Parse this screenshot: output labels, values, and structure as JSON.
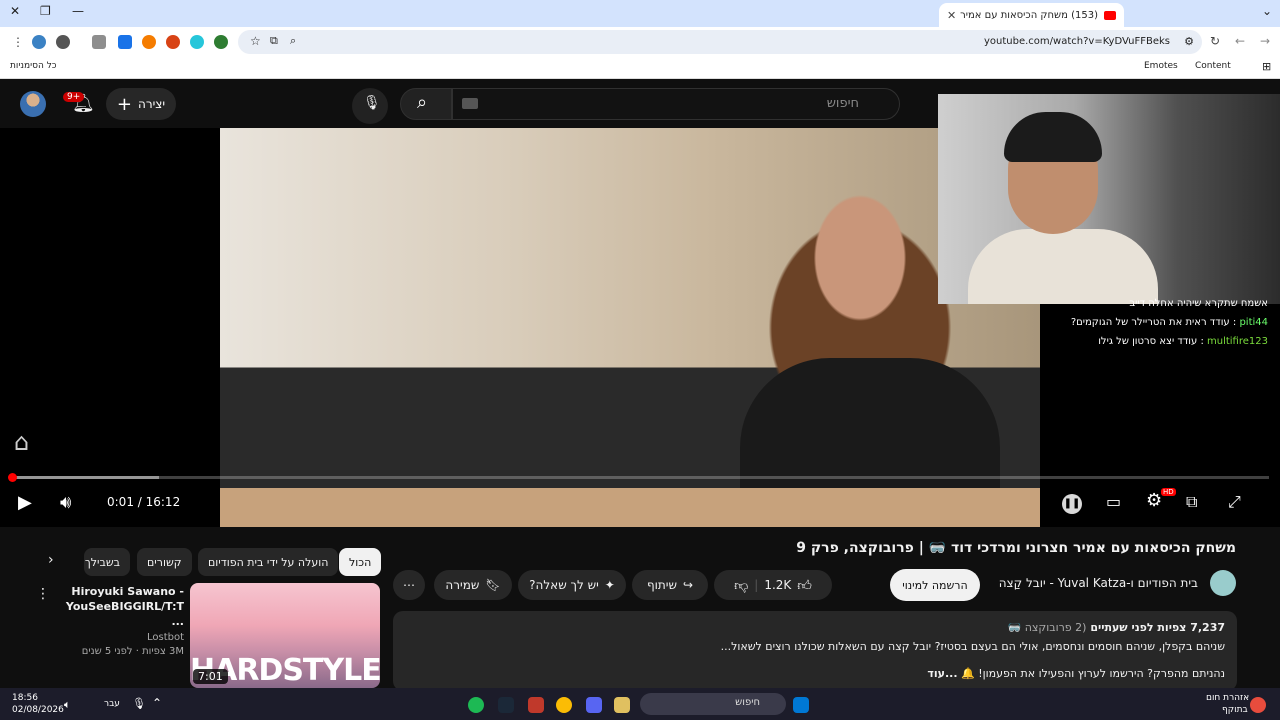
{
  "browser": {
    "tab_title": "(153) משחק הכיסאות עם אמיר",
    "tab_close": "✕",
    "new_tab": "+",
    "url": "youtube.com/watch?v=KyDVuFFBeks",
    "bookmarks": {
      "all_bookmarks": "כל הסימניות",
      "emotes": "Emotes",
      "content": "Content"
    }
  },
  "header": {
    "search_placeholder": "חיפוש",
    "create_label": "יצירה",
    "notification_count": "9+"
  },
  "stream_overlay": {
    "chat": [
      {
        "text": "אשמח שתקרא שיהיה אחלה דייב",
        "user": ""
      },
      {
        "user": "piti44",
        "text": ": עודד ראית את הטריילר של הגוקמים?"
      },
      {
        "user": "multifire123",
        "text": ": עודד יצא סרטון של גילו"
      }
    ]
  },
  "player": {
    "current_time": "0:01",
    "duration": "16:12",
    "time_display": "0:01 / 16:12",
    "progress": 0.001,
    "hd_badge": "HD"
  },
  "video": {
    "title": "משחק הכיסאות עם אמיר חצרוני ומרדכי דוד 🥽 | פרובוקצה, פרק 9",
    "channel": "בית הפודיום ו-Yuval Katza - יובל קַצה",
    "subscribe": "הרשמה למינוי",
    "likes": "1.2K",
    "share": "שיתוף",
    "ask": "יש לך שאלה?",
    "save": "שמירה",
    "views": "7,237 צפיות",
    "age": "לפני שעתיים",
    "tag": "(2 פרובוקצה 🥽",
    "description_line1": "שניהם בקפלן, שניהם חוסמים ונחסמים, אולי הם בעצם בסטיז? יובל קצה עם השאלות שכולנו רוצים לשאול...",
    "description_line2": "נהניתם מהפרק? הירשמו לערוץ והפעילו את הפעמון! 🔔",
    "more": "...עוד"
  },
  "chips": [
    "הכול",
    "הועלה על ידי בית הפודיום",
    "קשורים",
    "בשבילך"
  ],
  "recommendation": {
    "title": "Hiroyuki Sawano - YouSeeBIGGIRL/T:T ...",
    "channel": "Lostbot",
    "meta": "3M צפיות · לפני 5 שנים",
    "duration": "7:01",
    "thumb_text": "HARDSTYLE"
  },
  "taskbar": {
    "time": "18:56",
    "date": "02/08/2026",
    "lang": "עבר",
    "search": "חיפוש",
    "weather_temp": "אזהרת חום",
    "weather_note": "בתוקף"
  },
  "colors": {
    "accent": "#ff0000",
    "bg": "#0f0f0f",
    "surface": "#272727"
  }
}
